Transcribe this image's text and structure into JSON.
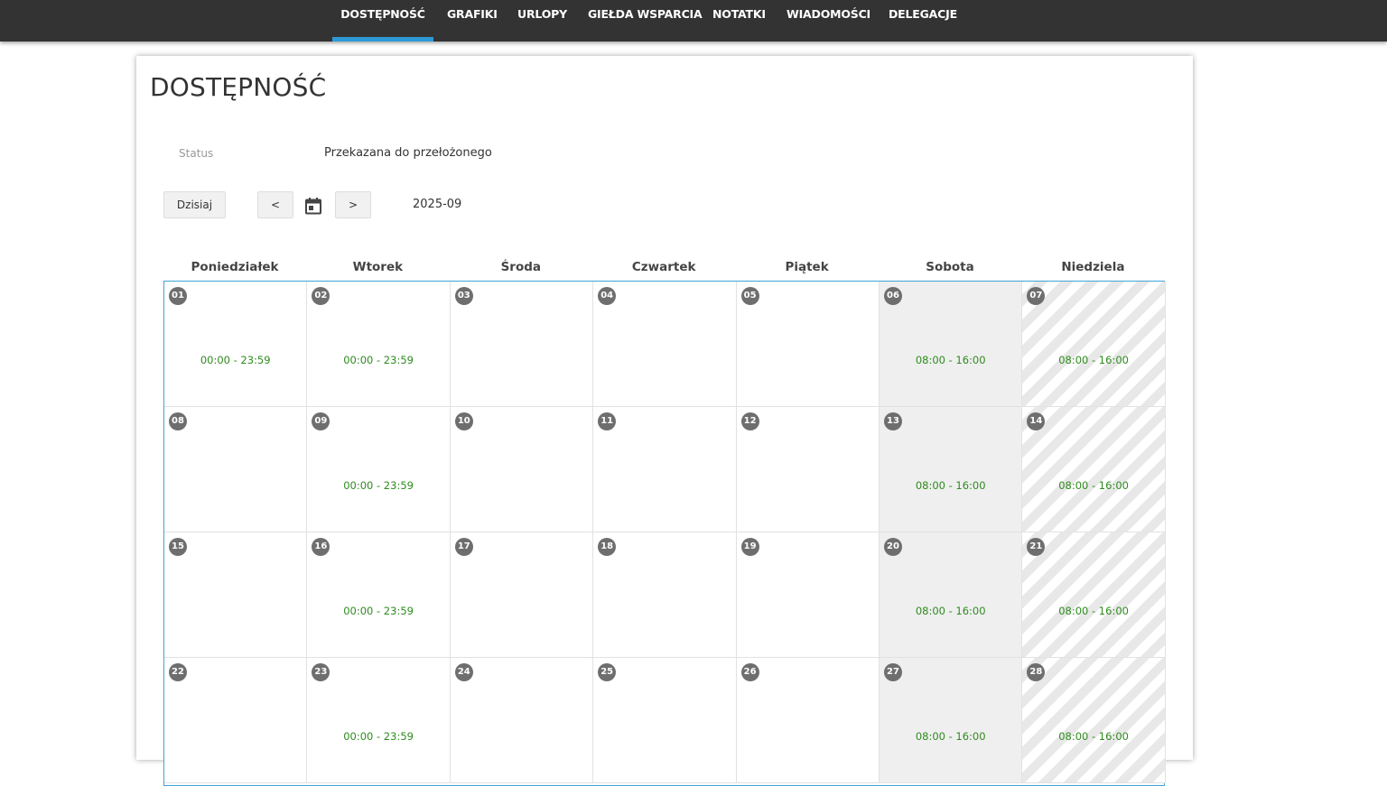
{
  "nav": {
    "items": [
      {
        "label": "DOSTĘPNOŚĆ",
        "active": true
      },
      {
        "label": "GRAFIKI"
      },
      {
        "label": "URLOPY"
      },
      {
        "label": "GIEŁDA WSPARCIA"
      },
      {
        "label": "NOTATKI"
      },
      {
        "label": "WIADOMOŚCI"
      },
      {
        "label": "DELEGACJE"
      }
    ]
  },
  "page": {
    "title": "DOSTĘPNOŚĆ",
    "status_label": "Status",
    "status_value": "Przekazana do przełożonego"
  },
  "toolbar": {
    "today_label": "Dzisiaj",
    "prev_label": "<",
    "next_label": ">",
    "calendar_icon": "calendar-icon",
    "month": "2025-09"
  },
  "calendar": {
    "weekdays": [
      "Poniedziałek",
      "Wtorek",
      "Środa",
      "Czwartek",
      "Piątek",
      "Sobota",
      "Niedziela"
    ],
    "weeks": [
      [
        {
          "day": "01",
          "avail": "00:00 - 23:59"
        },
        {
          "day": "02",
          "avail": "00:00 - 23:59"
        },
        {
          "day": "03",
          "avail": ""
        },
        {
          "day": "04",
          "avail": ""
        },
        {
          "day": "05",
          "avail": ""
        },
        {
          "day": "06",
          "avail": "08:00 - 16:00"
        },
        {
          "day": "07",
          "avail": "08:00 - 16:00"
        }
      ],
      [
        {
          "day": "08",
          "avail": ""
        },
        {
          "day": "09",
          "avail": "00:00 - 23:59"
        },
        {
          "day": "10",
          "avail": ""
        },
        {
          "day": "11",
          "avail": ""
        },
        {
          "day": "12",
          "avail": ""
        },
        {
          "day": "13",
          "avail": "08:00 - 16:00"
        },
        {
          "day": "14",
          "avail": "08:00 - 16:00"
        }
      ],
      [
        {
          "day": "15",
          "avail": ""
        },
        {
          "day": "16",
          "avail": "00:00 - 23:59"
        },
        {
          "day": "17",
          "avail": ""
        },
        {
          "day": "18",
          "avail": ""
        },
        {
          "day": "19",
          "avail": ""
        },
        {
          "day": "20",
          "avail": "08:00 - 16:00"
        },
        {
          "day": "21",
          "avail": "08:00 - 16:00"
        }
      ],
      [
        {
          "day": "22",
          "avail": ""
        },
        {
          "day": "23",
          "avail": "00:00 - 23:59"
        },
        {
          "day": "24",
          "avail": ""
        },
        {
          "day": "25",
          "avail": ""
        },
        {
          "day": "26",
          "avail": ""
        },
        {
          "day": "27",
          "avail": "08:00 - 16:00"
        },
        {
          "day": "28",
          "avail": "08:00 - 16:00"
        }
      ]
    ]
  },
  "colors": {
    "topbar": "#333333",
    "accent": "#2d9ad6",
    "available_text": "#2e8b1e",
    "day_badge": "#6e6e6e"
  }
}
